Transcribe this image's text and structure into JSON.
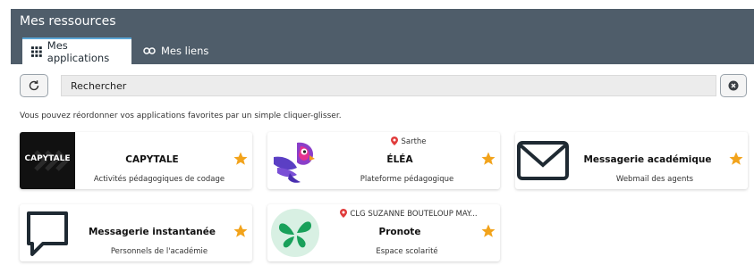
{
  "header": {
    "title": "Mes ressources"
  },
  "tabs": [
    {
      "label": "Mes applications",
      "icon": "grid-icon",
      "active": true
    },
    {
      "label": "Mes liens",
      "icon": "link-icon",
      "active": false
    }
  ],
  "search": {
    "placeholder": "Rechercher"
  },
  "hint": "Vous pouvez réordonner vos applications favorites par un simple cliquer-glisser.",
  "colors": {
    "header": "#4f5d6a",
    "accent_tab": "#5ba6d6",
    "star": "#f2a31b",
    "pin": "#e03b3b"
  },
  "apps": [
    {
      "name": "CAPYTALE",
      "description": "Activités pédagogiques de codage",
      "location": "",
      "logo_text": "CAPYTALE",
      "favorite": true
    },
    {
      "name": "ÉLÉA",
      "description": "Plateforme pédagogique",
      "location": "Sarthe",
      "favorite": true
    },
    {
      "name": "Messagerie académique",
      "description": "Webmail des agents",
      "location": "",
      "favorite": true
    },
    {
      "name": "Messagerie instantanée",
      "description": "Personnels de l'académie",
      "location": "",
      "favorite": true
    },
    {
      "name": "Pronote",
      "description": "Espace scolarité",
      "location": "CLG SUZANNE BOUTELOUP MAY...",
      "favorite": true
    }
  ]
}
